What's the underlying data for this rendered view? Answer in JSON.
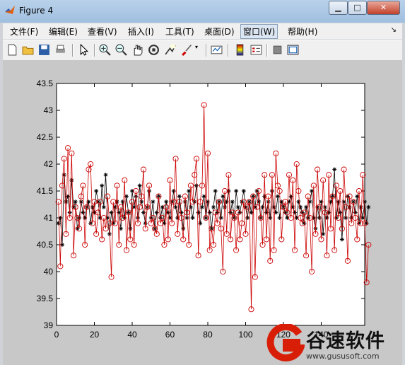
{
  "window": {
    "title": "Figure 4",
    "buttons": {
      "minimize": "▁",
      "maximize": "□",
      "close": "✕"
    }
  },
  "menu": {
    "items": [
      {
        "label": "文件(F)"
      },
      {
        "label": "编辑(E)"
      },
      {
        "label": "查看(V)"
      },
      {
        "label": "插入(I)"
      },
      {
        "label": "工具(T)"
      },
      {
        "label": "桌面(D)"
      },
      {
        "label": "窗口(W)"
      },
      {
        "label": "帮助(H)"
      }
    ],
    "overflow_arrow": "↘"
  },
  "toolbar": {
    "icons": [
      "new-file-icon",
      "open-folder-icon",
      "save-icon",
      "print-icon",
      "pointer-arrow-icon",
      "zoom-in-icon",
      "zoom-out-icon",
      "pan-hand-icon",
      "rotate-3d-icon",
      "data-cursor-icon",
      "brush-icon",
      "brush-dropdown-icon",
      "link-plot-icon",
      "colorbar-icon",
      "legend-icon",
      "hide-plot-tools-icon",
      "show-plot-tools-icon"
    ]
  },
  "chart_data": {
    "type": "line",
    "xlim": [
      0,
      163
    ],
    "ylim": [
      39,
      43.5
    ],
    "xticks": [
      0,
      20,
      40,
      60,
      80,
      100,
      120,
      140
    ],
    "yticks": [
      39,
      39.5,
      40,
      40.5,
      41,
      41.5,
      42,
      42.5,
      43,
      43.5
    ],
    "xtick_labels": [
      "0",
      "20",
      "40",
      "60",
      "80",
      "100",
      "120",
      "140"
    ],
    "ytick_labels": [
      "39",
      "39.5",
      "40",
      "40.5",
      "41",
      "41.5",
      "42",
      "42.5",
      "43",
      "43.5"
    ],
    "grid": false,
    "series": [
      {
        "marker": "asterisk",
        "color": "#000000",
        "values": [
          40.9,
          41.0,
          40.5,
          41.8,
          41.3,
          41.4,
          41.1,
          41.7,
          41.2,
          41.3,
          40.8,
          41.0,
          41.3,
          41.1,
          41.0,
          41.2,
          41.3,
          40.9,
          41.2,
          41.1,
          41.5,
          41.3,
          41.0,
          41.6,
          41.2,
          41.8,
          41.0,
          40.7,
          41.1,
          40.9,
          41.2,
          41.3,
          41.1,
          40.8,
          41.3,
          41.0,
          41.4,
          41.1,
          40.8,
          41.5,
          41.2,
          41.4,
          41.0,
          41.6,
          41.3,
          41.1,
          40.9,
          41.2,
          41.5,
          41.0,
          41.3,
          40.8,
          41.1,
          41.4,
          41.0,
          41.2,
          40.9,
          41.3,
          41.1,
          41.0,
          41.3,
          41.5,
          41.2,
          41.0,
          41.4,
          41.1,
          40.8,
          41.3,
          41.0,
          41.5,
          41.2,
          41.0,
          41.3,
          41.6,
          41.1,
          40.9,
          41.2,
          41.4,
          41.0,
          41.3,
          41.1,
          40.8,
          41.2,
          41.5,
          41.1,
          41.3,
          41.0,
          41.4,
          41.2,
          41.3,
          41.5,
          41.1,
          41.3,
          41.0,
          41.5,
          41.2,
          41.1,
          41.3,
          41.5,
          41.2,
          41.0,
          41.3,
          41.1,
          41.4,
          41.2,
          41.5,
          41.3,
          41.0,
          41.2,
          41.4,
          41.1,
          41.3,
          41.0,
          41.5,
          41.2,
          41.1,
          41.4,
          41.0,
          41.3,
          41.2,
          41.1,
          41.0,
          41.3,
          41.4,
          41.2,
          41.1,
          41.0,
          41.3,
          41.2,
          41.1,
          40.9,
          41.2,
          41.0,
          41.3,
          41.5,
          41.0,
          40.8,
          41.2,
          41.0,
          41.3,
          40.7,
          41.2,
          41.0,
          41.1,
          41.3,
          41.4,
          41.9,
          41.0,
          41.3,
          41.1,
          40.6,
          41.3,
          41.0,
          41.4,
          41.2,
          41.0,
          41.3,
          41.1,
          41.4,
          40.9,
          41.2,
          41.0,
          41.3,
          40.9,
          41.2
        ]
      },
      {
        "marker": "circle",
        "color": "#cc0000",
        "values": [
          41.3,
          40.1,
          41.6,
          42.1,
          40.7,
          42.3,
          41.0,
          42.2,
          40.3,
          41.2,
          41.0,
          40.8,
          41.4,
          41.6,
          40.5,
          41.2,
          41.9,
          42.0,
          40.9,
          41.3,
          40.7,
          41.1,
          41.3,
          40.6,
          41.0,
          40.8,
          41.4,
          40.9,
          39.9,
          41.3,
          40.9,
          41.6,
          40.5,
          41.2,
          41.0,
          41.7,
          40.4,
          41.1,
          40.6,
          41.3,
          40.5,
          41.5,
          40.9,
          41.2,
          41.4,
          41.9,
          40.8,
          41.2,
          41.6,
          40.9,
          41.0,
          40.8,
          40.7,
          41.4,
          40.9,
          41.0,
          40.5,
          41.2,
          40.6,
          41.7,
          40.9,
          41.3,
          42.1,
          40.7,
          41.3,
          41.0,
          40.6,
          41.4,
          41.1,
          40.5,
          41.6,
          41.3,
          41.8,
          42.1,
          40.3,
          41.3,
          41.6,
          43.1,
          41.0,
          42.2,
          40.4,
          40.8,
          40.5,
          41.1,
          40.9,
          41.3,
          40.8,
          40.0,
          41.5,
          40.7,
          41.8,
          40.6,
          41.1,
          41.0,
          40.4,
          41.1,
          40.6,
          40.9,
          41.3,
          40.7,
          41.2,
          41.3,
          39.3,
          41.4,
          39.9,
          41.2,
          41.5,
          41.0,
          40.5,
          41.8,
          40.6,
          41.4,
          40.2,
          41.8,
          40.4,
          42.2,
          41.6,
          41.5,
          40.6,
          41.2,
          41.3,
          41.1,
          41.8,
          41.0,
          41.7,
          40.4,
          42.0,
          41.5,
          41.0,
          40.9,
          41.1,
          40.3,
          41.4,
          41.0,
          40.0,
          41.6,
          40.7,
          41.9,
          41.2,
          40.6,
          41.7,
          41.1,
          40.3,
          41.8,
          40.8,
          41.4,
          40.4,
          41.6,
          41.0,
          41.5,
          40.8,
          41.9,
          41.2,
          40.2,
          41.4,
          40.9,
          41.3,
          41.0,
          40.6,
          41.5,
          40.9,
          41.8,
          40.9,
          39.8,
          40.5
        ]
      }
    ]
  },
  "watermark": {
    "logo": "G-logo",
    "brand_text": "谷速软件",
    "url": "www.gususoft.com",
    "color": "#d81e06"
  }
}
